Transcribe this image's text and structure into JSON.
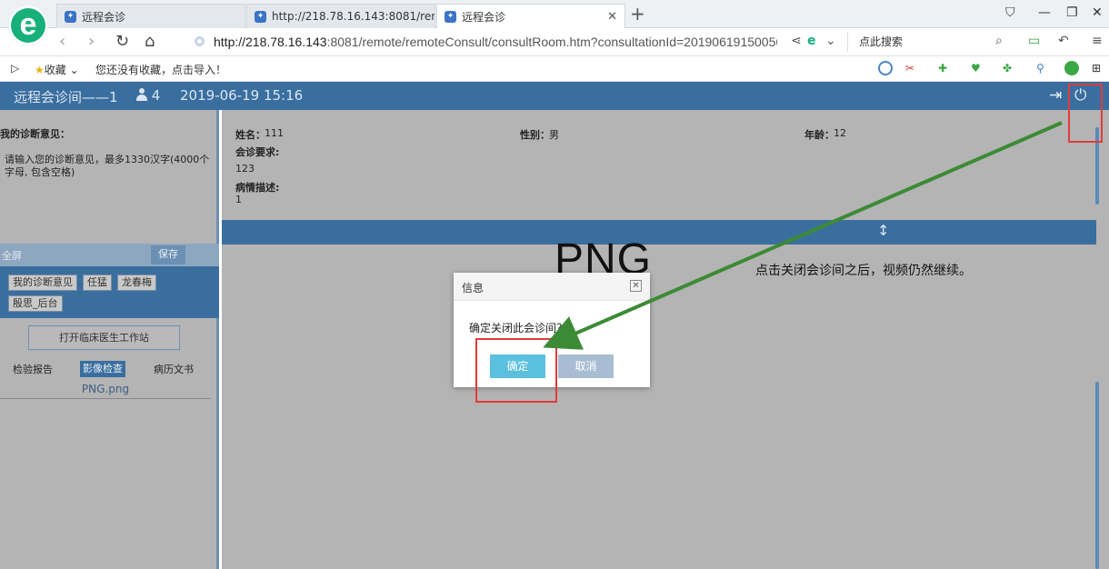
{
  "browser": {
    "tabs": [
      {
        "label": "远程会诊",
        "active": false
      },
      {
        "label": "http://218.78.16.143:8081/rem",
        "active": false
      },
      {
        "label": "远程会诊",
        "active": true
      }
    ],
    "logo_glyph": "e",
    "url_host": "http://218.78.16.143",
    "url_rest": ":8081/remote/remoteConsult/consultRoom.htm?consultationId=2019061915005610",
    "search_placeholder": "点此搜索",
    "favorites_label": "收藏",
    "favorites_hint": "您还没有收藏，点击导入！"
  },
  "app": {
    "title": "远程会诊间——1",
    "participant_count": "4",
    "datetime": "2019-06-19 15:16"
  },
  "left_panel": {
    "opinion_title": "我的诊断意见：",
    "opinion_placeholder": "请输入您的诊断意见，最多1330汉字(4000个字母, 包含空格)",
    "fullscreen_label": "全屏",
    "save_label": "保存",
    "tags": [
      "我的诊断意见",
      "任猛",
      "龙春梅",
      "殷思_后台"
    ],
    "open_workstation_label": "打开临床医生工作站",
    "doc_tabs": [
      "检验报告",
      "影像检查",
      "病历文书"
    ],
    "active_doc_tab": "影像检查",
    "file_name": "PNG.png"
  },
  "patient": {
    "name_label": "姓名：",
    "name_value": "111",
    "gender_label": "性别：",
    "gender_value": "男",
    "age_label": "年龄：",
    "age_value": "12",
    "requirement_label": "会诊要求:",
    "requirement_value": "123",
    "description_label": "病情描述:",
    "description_value": "1"
  },
  "viewer": {
    "image_text": "PNG"
  },
  "dialog": {
    "title": "信息",
    "message": "确定关闭此会诊间？",
    "confirm_label": "确定",
    "cancel_label": "取消"
  },
  "annotation": {
    "text": "点击关闭会诊间之后，视频仍然继续。",
    "arrow_color": "#3c8a35",
    "box_color": "#e23b3b"
  }
}
